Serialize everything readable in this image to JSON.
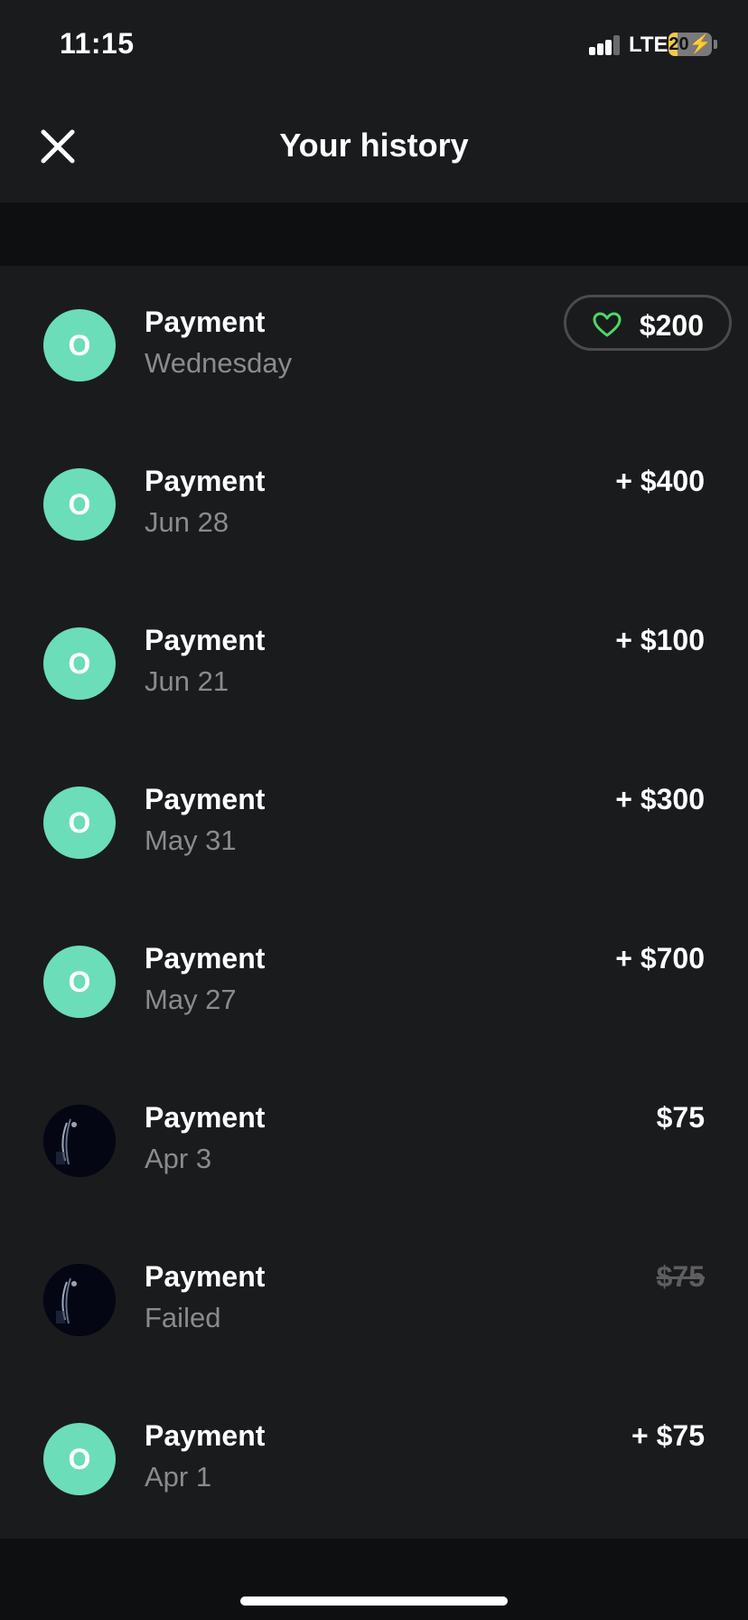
{
  "status_bar": {
    "time": "11:15",
    "network": "LTE",
    "battery_level": "20",
    "battery_fraction": 0.2
  },
  "header": {
    "title": "Your history",
    "close_icon": "close-icon"
  },
  "colors": {
    "background": "#1a1b1d",
    "avatar_accent": "#6bddb8",
    "heart_green": "#4cd964",
    "muted_text": "#8b8b8e"
  },
  "transactions": [
    {
      "avatar_type": "initial",
      "initial": "O",
      "title": "Payment",
      "subtitle": "Wednesday",
      "amount": "$200",
      "amount_style": "pill",
      "icon": "heart-icon"
    },
    {
      "avatar_type": "initial",
      "initial": "O",
      "title": "Payment",
      "subtitle": "Jun 28",
      "amount": "+ $400",
      "amount_style": "normal"
    },
    {
      "avatar_type": "initial",
      "initial": "O",
      "title": "Payment",
      "subtitle": "Jun 21",
      "amount": "+ $100",
      "amount_style": "normal"
    },
    {
      "avatar_type": "initial",
      "initial": "O",
      "title": "Payment",
      "subtitle": "May 31",
      "amount": "+ $300",
      "amount_style": "normal"
    },
    {
      "avatar_type": "initial",
      "initial": "O",
      "title": "Payment",
      "subtitle": "May 27",
      "amount": "+ $700",
      "amount_style": "normal"
    },
    {
      "avatar_type": "photo",
      "title": "Payment",
      "subtitle": "Apr 3",
      "amount": "$75",
      "amount_style": "normal"
    },
    {
      "avatar_type": "photo",
      "title": "Payment",
      "subtitle": "Failed",
      "amount": "$75",
      "amount_style": "failed"
    },
    {
      "avatar_type": "initial",
      "initial": "O",
      "title": "Payment",
      "subtitle": "Apr 1",
      "amount": "+ $75",
      "amount_style": "normal"
    }
  ]
}
